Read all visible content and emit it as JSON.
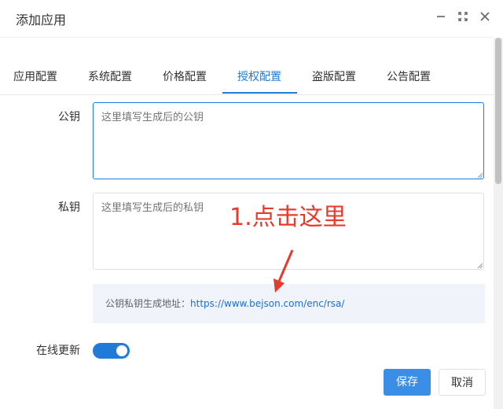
{
  "dialog": {
    "title": "添加应用",
    "controls": [
      "minimize-icon",
      "maximize-icon",
      "close-icon"
    ]
  },
  "tabs": [
    {
      "label": "应用配置"
    },
    {
      "label": "系统配置"
    },
    {
      "label": "价格配置"
    },
    {
      "label": "授权配置",
      "active": true
    },
    {
      "label": "盗版配置"
    },
    {
      "label": "公告配置"
    }
  ],
  "form": {
    "public_key": {
      "label": "公钥",
      "placeholder": "这里填写生成后的公钥",
      "value": ""
    },
    "private_key": {
      "label": "私钥",
      "placeholder": "这里填写生成后的私钥",
      "value": ""
    },
    "info": {
      "prefix": "公钥私钥生成地址：",
      "link": "https://www.bejson.com/enc/rsa/"
    },
    "online_update": {
      "label": "在线更新",
      "enabled": true
    }
  },
  "annotation": {
    "text": "1.点击这里",
    "color": "#e53b2c"
  },
  "buttons": {
    "save": "保存",
    "cancel": "取消"
  },
  "colors": {
    "accent": "#1f7ad8",
    "primary_button": "#3a8ee6",
    "annotation": "#e53b2c"
  }
}
